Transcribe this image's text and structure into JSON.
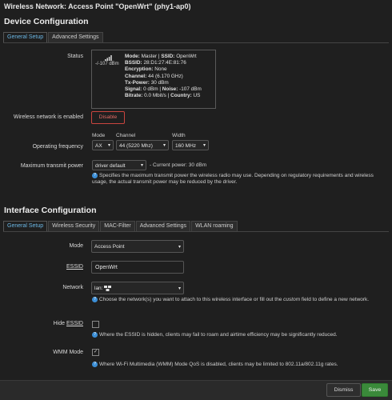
{
  "page_title": "Wireless Network: Access Point \"OpenWrt\" (phy1-ap0)",
  "device_config": {
    "title": "Device Configuration",
    "tabs": [
      "General Setup",
      "Advanced Settings"
    ],
    "status_label": "Status",
    "signal_dbm": "-/-107 dBm",
    "status": {
      "mode_k": "Mode:",
      "mode_v": "Master",
      "ssid_k": "SSID:",
      "ssid_v": "OpenWrt",
      "bssid_k": "BSSID:",
      "bssid_v": "28:D1:27:4E:81:76",
      "enc_k": "Encryption:",
      "enc_v": "None",
      "chan_k": "Channel:",
      "chan_v": "44 (6.170 GHz)",
      "tx_k": "Tx-Power:",
      "tx_v": "30 dBm",
      "sig_k": "Signal:",
      "sig_v": "0 dBm",
      "noise_k": "Noise:",
      "noise_v": "-107 dBm",
      "bitrate_k": "Bitrate:",
      "bitrate_v": "0.0 Mbit/s",
      "country_k": "Country:",
      "country_v": "US"
    },
    "enabled_label": "Wireless network is enabled",
    "disable_btn": "Disable",
    "freq_label": "Operating frequency",
    "mode_lbl": "Mode",
    "channel_lbl": "Channel",
    "width_lbl": "Width",
    "mode_val": "AX",
    "channel_val": "44 (5220 Mhz)",
    "width_val": "160 MHz",
    "txpower_label": "Maximum transmit power",
    "txpower_val": "driver default",
    "txpower_current": "- Current power: 30 dBm",
    "txpower_hint": "Specifies the maximum transmit power the wireless radio may use. Depending on regulatory requirements and wireless usage, the actual transmit power may be reduced by the driver."
  },
  "iface_config": {
    "title": "Interface Configuration",
    "tabs": [
      "General Setup",
      "Wireless Security",
      "MAC-Filter",
      "Advanced Settings",
      "WLAN roaming"
    ],
    "mode_label": "Mode",
    "mode_val": "Access Point",
    "essid_label": "ESSID",
    "essid_val": "OpenWrt",
    "network_label": "Network",
    "network_val": "lan:",
    "network_hint_a": "Choose the network(s) you want to attach to this wireless interface or fill out the",
    "network_hint_em": "custom",
    "network_hint_b": "field to define a new network.",
    "hide_label": "Hide",
    "hide_essid": "ESSID",
    "hide_hint": "Where the ESSID is hidden, clients may fail to roam and airtime efficiency may be significantly reduced.",
    "wmm_label": "WMM Mode",
    "wmm_check": "✓",
    "wmm_hint": "Where Wi-Fi Multimedia (WMM) Mode QoS is disabled, clients may be limited to 802.11a/802.11g rates."
  },
  "footer": {
    "dismiss": "Dismiss",
    "save": "Save"
  },
  "colors": {
    "accent": "#6cb8e6",
    "danger": "#c9453f",
    "save": "#3a8a3a"
  },
  "icons": {
    "help": "help-icon",
    "signal": "signal-icon",
    "network": "network-icon"
  }
}
